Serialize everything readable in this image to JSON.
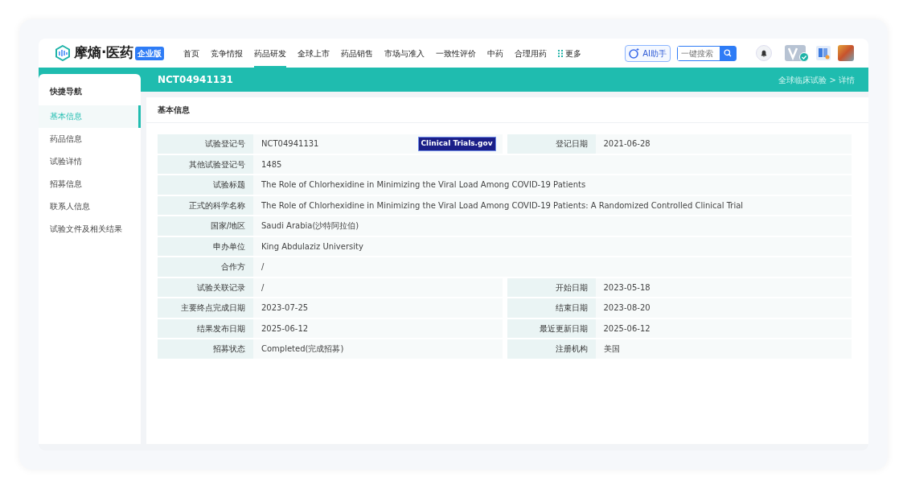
{
  "header": {
    "logo": "摩熵·医药",
    "edition": "企业版",
    "nav": [
      {
        "label": "首页",
        "selected": false
      },
      {
        "label": "竞争情报",
        "selected": false
      },
      {
        "label": "药品研发",
        "selected": true
      },
      {
        "label": "全球上市",
        "selected": false
      },
      {
        "label": "药品销售",
        "selected": false
      },
      {
        "label": "市场与准入",
        "selected": false
      },
      {
        "label": "一致性评价",
        "selected": false
      },
      {
        "label": "中药",
        "selected": false
      },
      {
        "label": "合理用药",
        "selected": false
      },
      {
        "label": "更多",
        "selected": false
      }
    ],
    "ai_button": "AI助手",
    "search_placeholder": "一键搜索"
  },
  "title_bar": {
    "title": "NCT04941131",
    "breadcrumb": "全球临床试验 > 详情"
  },
  "sidebar": {
    "title": "快捷导航",
    "items": [
      {
        "label": "基本信息",
        "selected": true
      },
      {
        "label": "药品信息",
        "selected": false
      },
      {
        "label": "试验详情",
        "selected": false
      },
      {
        "label": "招募信息",
        "selected": false
      },
      {
        "label": "联系人信息",
        "selected": false
      },
      {
        "label": "试验文件及相关结果",
        "selected": false
      }
    ]
  },
  "section": {
    "title": "基本信息",
    "rows": [
      {
        "fields": [
          {
            "label": "试验登记号",
            "value": "NCT04941131",
            "badge": "Clinical Trials.gov"
          },
          {
            "label": "登记日期",
            "value": "2021-06-28"
          }
        ]
      },
      {
        "fields": [
          {
            "label": "其他试验登记号",
            "value": "1485"
          }
        ]
      },
      {
        "fields": [
          {
            "label": "试验标题",
            "value": "The Role of Chlorhexidine in Minimizing the Viral Load Among COVID-19 Patients"
          }
        ]
      },
      {
        "fields": [
          {
            "label": "正式的科学名称",
            "value": "The Role of Chlorhexidine in Minimizing the Viral Load Among COVID-19 Patients: A Randomized Controlled Clinical Trial"
          }
        ]
      },
      {
        "fields": [
          {
            "label": "国家/地区",
            "value": "Saudi Arabia(沙特阿拉伯)"
          }
        ]
      },
      {
        "fields": [
          {
            "label": "申办单位",
            "value": "King Abdulaziz University"
          }
        ]
      },
      {
        "fields": [
          {
            "label": "合作方",
            "value": "/"
          }
        ]
      },
      {
        "fields": [
          {
            "label": "试验关联记录",
            "value": "/"
          },
          {
            "label": "开始日期",
            "value": "2023-05-18"
          }
        ]
      },
      {
        "fields": [
          {
            "label": "主要终点完成日期",
            "value": "2023-07-25"
          },
          {
            "label": "结束日期",
            "value": "2023-08-20"
          }
        ]
      },
      {
        "fields": [
          {
            "label": "结果发布日期",
            "value": "2025-06-12"
          },
          {
            "label": "最近更新日期",
            "value": "2025-06-12"
          }
        ]
      },
      {
        "fields": [
          {
            "label": "招募状态",
            "value": "Completed(完成招募)"
          },
          {
            "label": "注册机构",
            "value": "美国"
          }
        ]
      }
    ]
  }
}
